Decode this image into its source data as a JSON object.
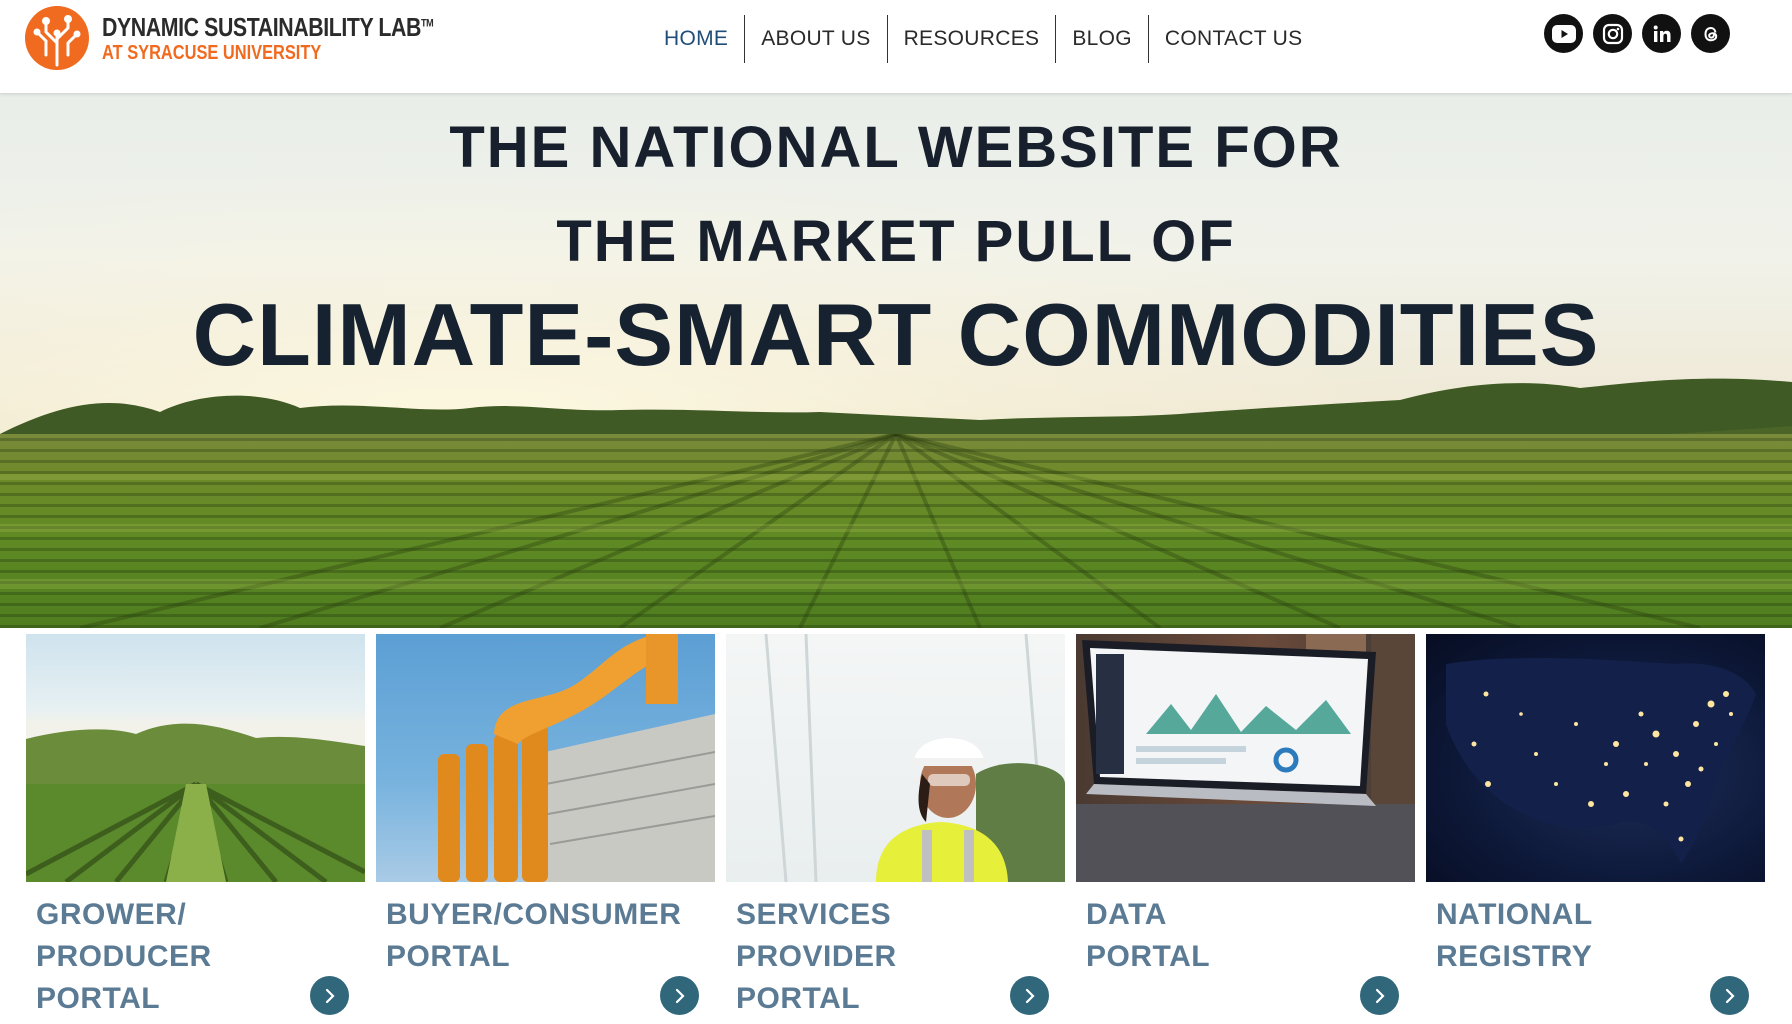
{
  "header": {
    "logo": {
      "line1": "DYNAMIC SUSTAINABILITY LAB",
      "trademark": "TM",
      "line2": "AT SYRACUSE UNIVERSITY"
    },
    "nav": [
      {
        "label": "HOME",
        "active": true
      },
      {
        "label": "ABOUT US",
        "active": false
      },
      {
        "label": "RESOURCES",
        "active": false
      },
      {
        "label": "BLOG",
        "active": false
      },
      {
        "label": "CONTACT US",
        "active": false
      }
    ],
    "social": [
      "youtube-icon",
      "instagram-icon",
      "linkedin-icon",
      "threads-icon"
    ]
  },
  "hero": {
    "line1": "THE NATIONAL WEBSITE  FOR",
    "line2": "THE MARKET PULL OF",
    "line3": "CLIMATE-SMART COMMODITIES"
  },
  "cards": [
    {
      "label": "GROWER/\nPRODUCER\nPORTAL",
      "image": "vineyard-photo"
    },
    {
      "label": "BUYER/CONSUMER\nPORTAL",
      "image": "industrial-pipes-photo"
    },
    {
      "label": "SERVICES\nPROVIDER\nPORTAL",
      "image": "engineer-worker-photo"
    },
    {
      "label": "DATA\nPORTAL",
      "image": "laptop-dashboard-photo"
    },
    {
      "label": "NATIONAL\nREGISTRY",
      "image": "us-night-lights-photo"
    }
  ],
  "colors": {
    "brand_orange": "#f06a1f",
    "nav_active": "#1f4e79",
    "card_label": "#5b7a93",
    "arrow_button": "#31677a",
    "hero_text": "#172230"
  }
}
